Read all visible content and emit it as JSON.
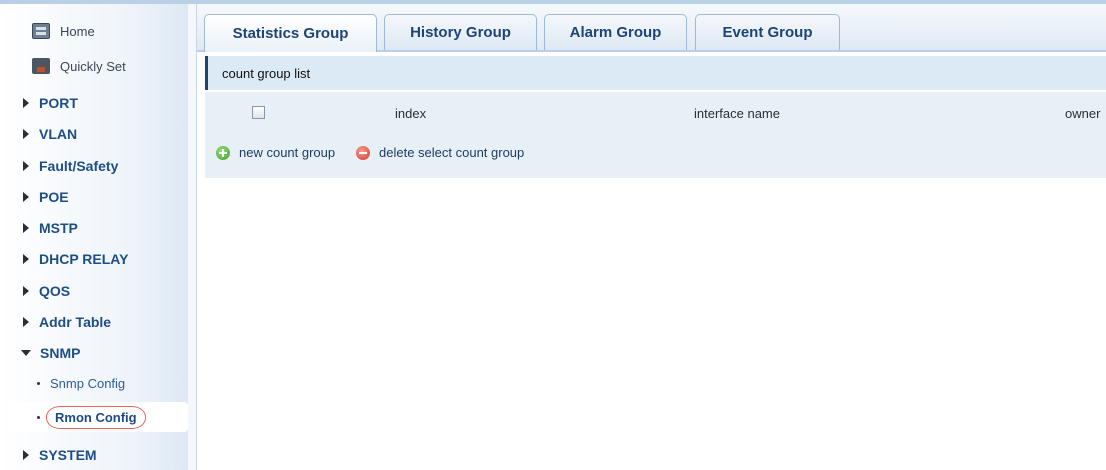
{
  "sidebar": {
    "top_items": [
      {
        "label": "Home",
        "icon": "home-icon"
      },
      {
        "label": "Quickly Set",
        "icon": "quick-set-icon"
      }
    ],
    "menus": [
      {
        "label": "PORT",
        "expanded": false
      },
      {
        "label": "VLAN",
        "expanded": false
      },
      {
        "label": "Fault/Safety",
        "expanded": false
      },
      {
        "label": "POE",
        "expanded": false
      },
      {
        "label": "MSTP",
        "expanded": false
      },
      {
        "label": "DHCP RELAY",
        "expanded": false
      },
      {
        "label": "QOS",
        "expanded": false
      },
      {
        "label": "Addr Table",
        "expanded": false
      },
      {
        "label": "SNMP",
        "expanded": true
      },
      {
        "label": "SYSTEM",
        "expanded": false
      }
    ],
    "snmp_sub": [
      {
        "label": "Snmp Config",
        "active": false
      },
      {
        "label": "Rmon Config",
        "active": true
      }
    ]
  },
  "tabs": [
    {
      "label": "Statistics Group",
      "active": true
    },
    {
      "label": "History Group",
      "active": false
    },
    {
      "label": "Alarm Group",
      "active": false
    },
    {
      "label": "Event Group",
      "active": false
    }
  ],
  "main": {
    "section_title": "count group list",
    "table_headers": {
      "index": "index",
      "interface_name": "interface name",
      "owner": "owner"
    },
    "select_all_checked": false,
    "actions": {
      "new": "new count group",
      "delete": "delete select count group"
    }
  },
  "colors": {
    "accent": "#1e4476",
    "header_bg": "#dceaf5",
    "active_highlight": "#e0665e"
  }
}
